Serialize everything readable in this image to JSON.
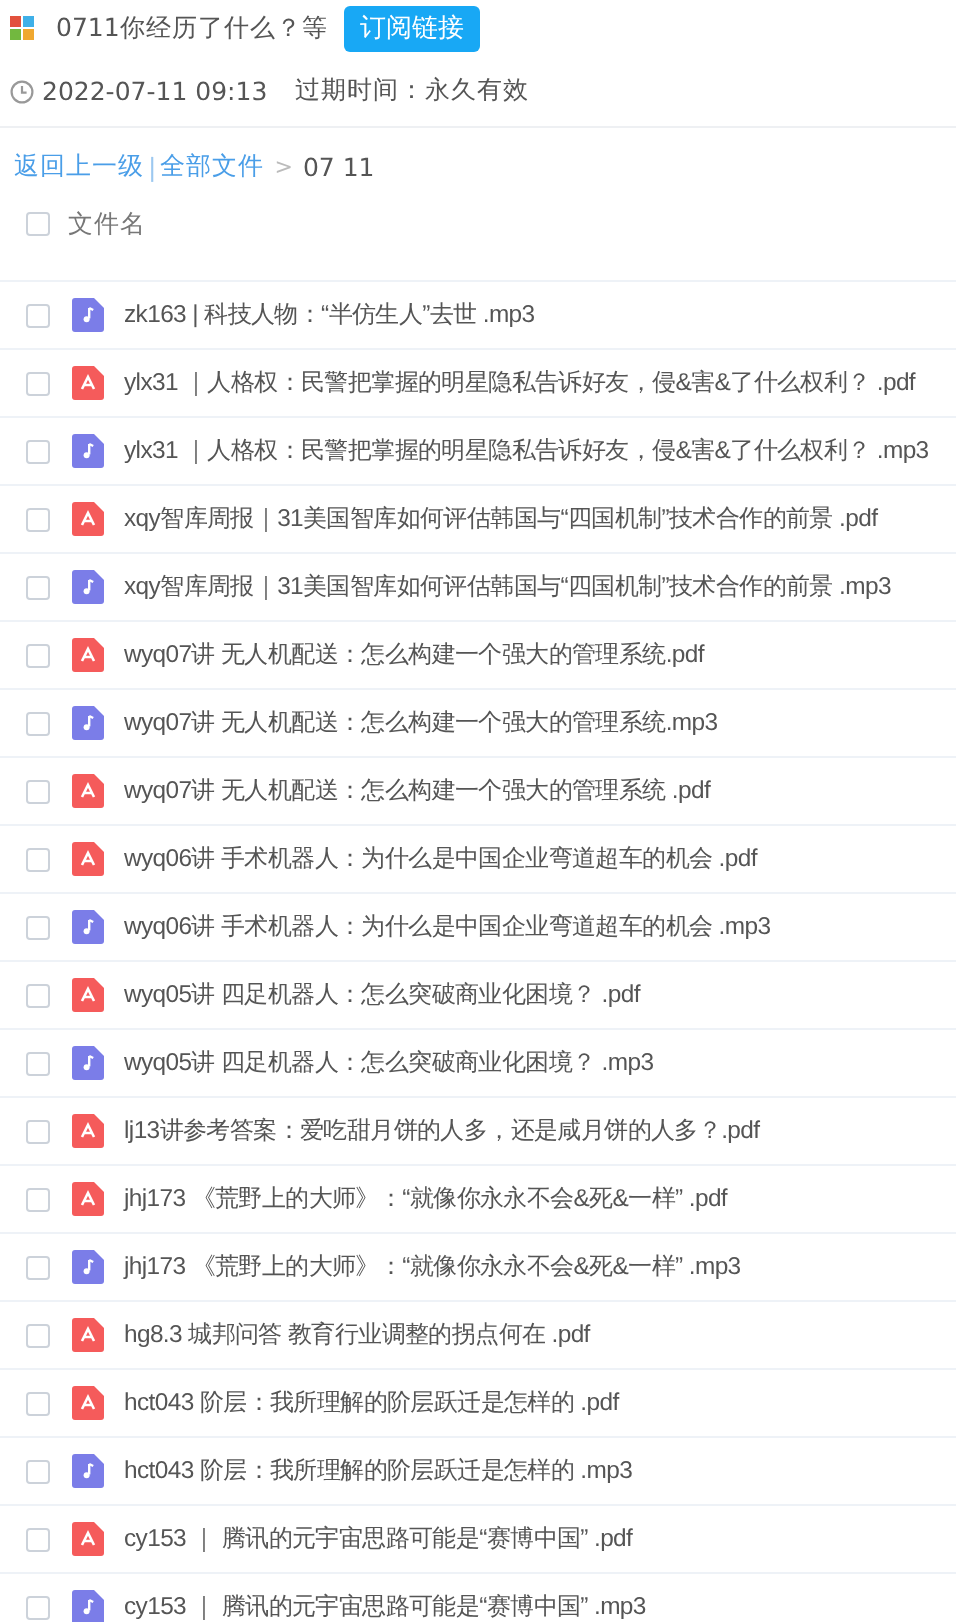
{
  "share": {
    "title": "0711你经历了什么？等",
    "subscribe_button": "订阅链接",
    "date": "2022-07-11 09:13",
    "expiry": "过期时间：永久有效"
  },
  "breadcrumb": {
    "back": "返回上一级",
    "separator": "|",
    "root": "全部文件",
    "arrow": ">",
    "current": "07 11"
  },
  "table": {
    "columns": [
      {
        "label": "文件名",
        "checked": false
      }
    ],
    "rows": [
      {
        "name": "zk163 | 科技人物：“半仿生人”去世 .mp3",
        "kind": "mp3",
        "checked": false
      },
      {
        "name": "ylx31 ｜人格权：民警把掌握的明星隐私告诉好友，侵&害&了什么权利？ .pdf",
        "kind": "pdf",
        "checked": false
      },
      {
        "name": "ylx31 ｜人格权：民警把掌握的明星隐私告诉好友，侵&害&了什么权利？ .mp3",
        "kind": "mp3",
        "checked": false
      },
      {
        "name": "xqy智库周报｜31美国智库如何评估韩国与“四国机制”技术合作的前景 .pdf",
        "kind": "pdf",
        "checked": false
      },
      {
        "name": "xqy智库周报｜31美国智库如何评估韩国与“四国机制”技术合作的前景 .mp3",
        "kind": "mp3",
        "checked": false
      },
      {
        "name": "wyq07讲 无人机配送：怎么构建一个强大的管理系统.pdf",
        "kind": "pdf",
        "checked": false
      },
      {
        "name": "wyq07讲 无人机配送：怎么构建一个强大的管理系统.mp3",
        "kind": "mp3",
        "checked": false
      },
      {
        "name": "wyq07讲 无人机配送：怎么构建一个强大的管理系统 .pdf",
        "kind": "pdf",
        "checked": false
      },
      {
        "name": "wyq06讲 手术机器人：为什么是中国企业弯道超车的机会 .pdf",
        "kind": "pdf",
        "checked": false
      },
      {
        "name": "wyq06讲 手术机器人：为什么是中国企业弯道超车的机会 .mp3",
        "kind": "mp3",
        "checked": false
      },
      {
        "name": "wyq05讲 四足机器人：怎么突破商业化困境？ .pdf",
        "kind": "pdf",
        "checked": false
      },
      {
        "name": "wyq05讲 四足机器人：怎么突破商业化困境？ .mp3",
        "kind": "mp3",
        "checked": false
      },
      {
        "name": "lj13讲参考答案：爱吃甜月饼的人多，还是咸月饼的人多？.pdf",
        "kind": "pdf",
        "checked": false
      },
      {
        "name": "jhj173 《荒野上的大师》：“就像你永永不会&死&一样” .pdf",
        "kind": "pdf",
        "checked": false
      },
      {
        "name": "jhj173 《荒野上的大师》：“就像你永永不会&死&一样” .mp3",
        "kind": "mp3",
        "checked": false
      },
      {
        "name": "hg8.3 城邦问答 教育行业调整的拐点何在 .pdf",
        "kind": "pdf",
        "checked": false
      },
      {
        "name": "hct043 阶层：我所理解的阶层跃迁是怎样的 .pdf",
        "kind": "pdf",
        "checked": false
      },
      {
        "name": "hct043 阶层：我所理解的阶层跃迁是怎样的 .mp3",
        "kind": "mp3",
        "checked": false
      },
      {
        "name": "cy153 ｜ 腾讯的元宇宙思路可能是“赛博中国” .pdf",
        "kind": "pdf",
        "checked": false
      },
      {
        "name": "cy153 ｜ 腾讯的元宇宙思路可能是“赛博中国” .mp3",
        "kind": "mp3",
        "checked": false
      }
    ]
  }
}
